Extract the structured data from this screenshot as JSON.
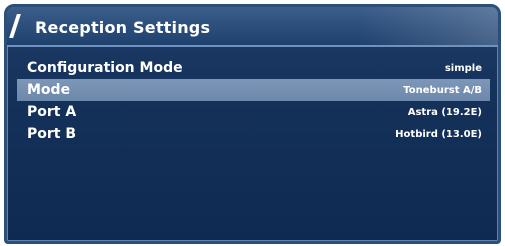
{
  "window": {
    "title": "Reception Settings"
  },
  "settings": {
    "rows": [
      {
        "label": "Configuration Mode",
        "value": "simple",
        "selected": false
      },
      {
        "label": "Mode",
        "value": "Toneburst A/B",
        "selected": true
      },
      {
        "label": "Port A",
        "value": "Astra (19.2E)",
        "selected": false
      },
      {
        "label": "Port B",
        "value": "Hotbird (13.0E)",
        "selected": false
      }
    ]
  },
  "colors": {
    "panel_background": "#14315a",
    "title_bar": "#2e507d",
    "selection_highlight": "#7190b3",
    "text": "#ffffff"
  }
}
